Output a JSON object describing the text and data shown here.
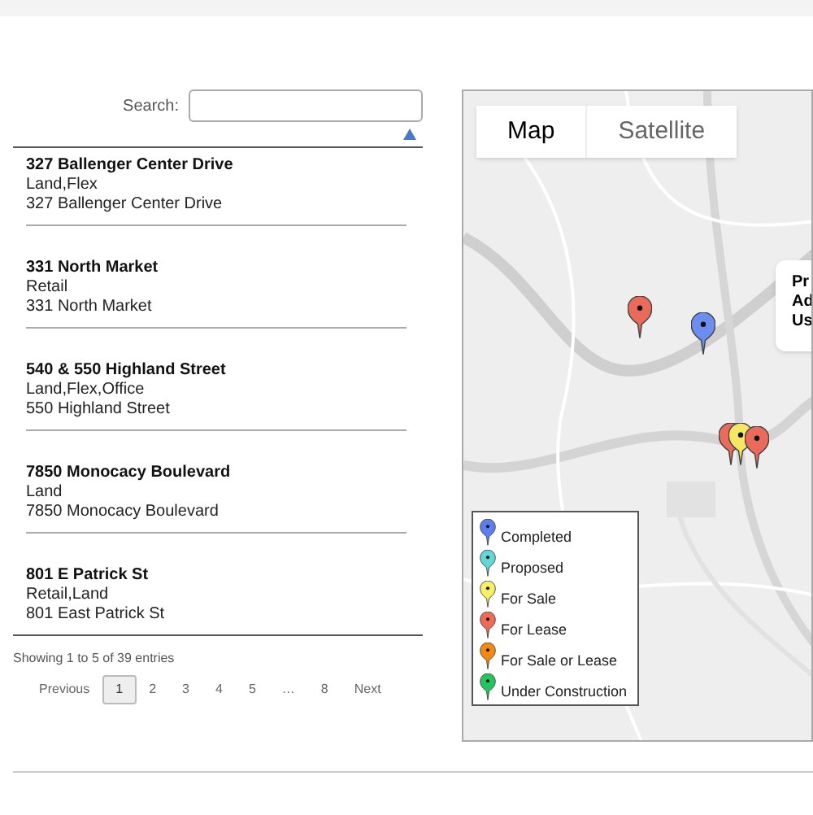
{
  "search": {
    "label": "Search:"
  },
  "listings": [
    {
      "title": "327 Ballenger Center Drive",
      "types": "Land,Flex",
      "address": "327 Ballenger Center Drive"
    },
    {
      "title": "331 North Market",
      "types": "Retail",
      "address": "331 North Market"
    },
    {
      "title": "540 & 550 Highland Street",
      "types": "Land,Flex,Office",
      "address": "550 Highland Street"
    },
    {
      "title": "7850 Monocacy Boulevard",
      "types": "Land",
      "address": "7850 Monocacy Boulevard"
    },
    {
      "title": "801 E Patrick St",
      "types": "Retail,Land",
      "address": "801 East Patrick St"
    }
  ],
  "info": "Showing 1 to 5 of 39 entries",
  "pagination": [
    {
      "label": "Previous",
      "selected": false
    },
    {
      "label": "1",
      "selected": true
    },
    {
      "label": "2",
      "selected": false
    },
    {
      "label": "3",
      "selected": false
    },
    {
      "label": "4",
      "selected": false
    },
    {
      "label": "5",
      "selected": false
    },
    {
      "label": "…",
      "selected": false
    },
    {
      "label": "8",
      "selected": false
    },
    {
      "label": "Next",
      "selected": false
    }
  ],
  "map": {
    "type_tabs": [
      {
        "label": "Map",
        "selected": true
      },
      {
        "label": "Satellite",
        "selected": false
      }
    ],
    "info_window": [
      "Pr",
      "Ad",
      "Us"
    ],
    "pins": [
      {
        "color": "#ea6b5c"
      },
      {
        "color": "#6b8ef0"
      },
      {
        "color": "#ea6b5c"
      },
      {
        "color": "#f5e663"
      },
      {
        "color": "#ea6b5c"
      }
    ],
    "legend": [
      {
        "label": "Completed",
        "color": "#5b7ff0"
      },
      {
        "label": "Proposed",
        "color": "#5fd8d6"
      },
      {
        "label": "For Sale",
        "color": "#f8f064"
      },
      {
        "label": "For Lease",
        "color": "#f06a5a"
      },
      {
        "label": "For Sale or Lease",
        "color": "#f38a0f"
      },
      {
        "label": "Under Construction",
        "color": "#22c55e"
      }
    ]
  }
}
